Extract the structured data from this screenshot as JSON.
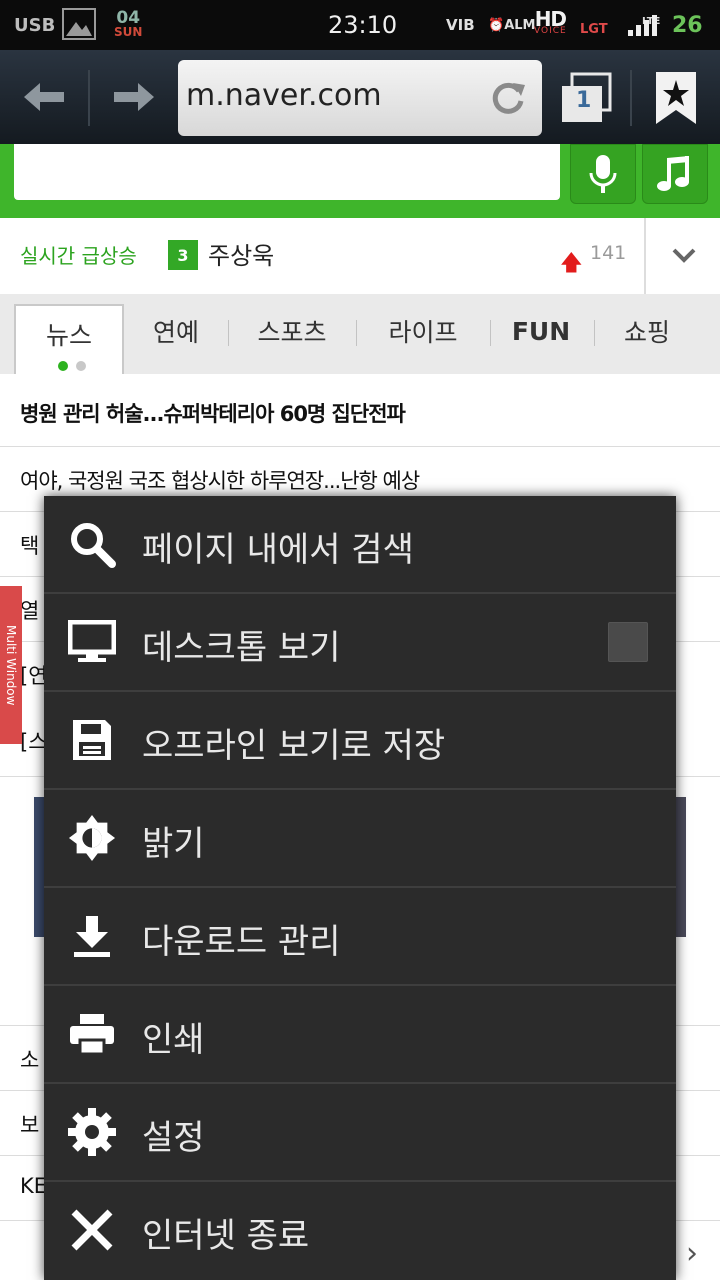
{
  "status_bar": {
    "usb": "USB",
    "date_day": "04",
    "date_weekday": "SUN",
    "clock": "23:10",
    "vib": "VIB",
    "alarm": "ALM",
    "hd": "HD",
    "hd_sub": "VOICE",
    "carrier": "LGT",
    "network": "LTE",
    "battery": "26"
  },
  "toolbar": {
    "url": "m.naver.com",
    "tab_count": "1"
  },
  "realtime": {
    "title": "실시간 급상승",
    "rank": "3",
    "keyword": "주상욱",
    "count": "141"
  },
  "category_tabs": [
    "뉴스",
    "연예",
    "스포츠",
    "라이프",
    "FUN",
    "쇼핑"
  ],
  "news": [
    "병원 관리 허술...슈퍼박테리아 60명 집단전파",
    "여야, 국정원 국조 협상시한 하루연장...난항 예상",
    "택",
    "열",
    "[연",
    "[스",
    "소",
    "보",
    "KE"
  ],
  "multi_window": "Multi Window",
  "menu": {
    "items": [
      {
        "label": "페이지 내에서 검색",
        "icon": "search-icon"
      },
      {
        "label": "데스크톱 보기",
        "icon": "monitor-icon"
      },
      {
        "label": "오프라인 보기로 저장",
        "icon": "save-icon"
      },
      {
        "label": "밝기",
        "icon": "brightness-icon"
      },
      {
        "label": "다운로드 관리",
        "icon": "download-icon"
      },
      {
        "label": "인쇄",
        "icon": "print-icon"
      },
      {
        "label": "설정",
        "icon": "gear-icon"
      },
      {
        "label": "인터넷 종료",
        "icon": "close-icon"
      }
    ]
  },
  "colors": {
    "naver_green": "#3fb52b",
    "menu_bg": "#2b2b2b"
  }
}
